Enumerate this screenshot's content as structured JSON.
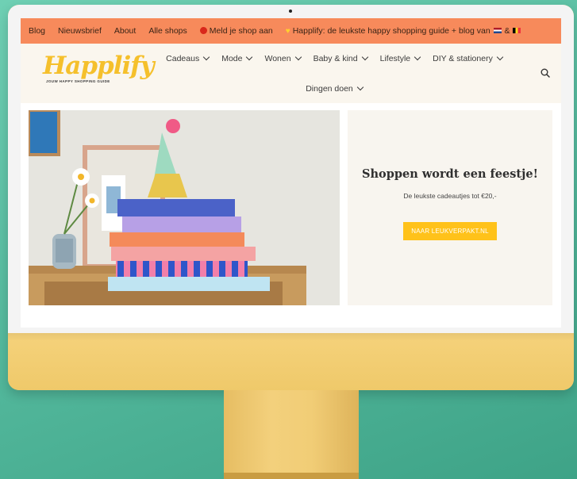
{
  "topbar": {
    "items": [
      "Blog",
      "Nieuwsbrief",
      "About",
      "Alle shops"
    ],
    "shop_label": "Meld je shop aan",
    "tagline": "Happlify: de leukste happy shopping guide + blog van",
    "tagline_amp": "&"
  },
  "logo": {
    "name": "Happlify",
    "tagline": "JOUW HAPPY SHOPPING GUIDE"
  },
  "nav": {
    "items": [
      "Cadeaus",
      "Mode",
      "Wonen",
      "Baby & kind",
      "Lifestyle",
      "DIY & stationery",
      "Dingen doen"
    ]
  },
  "icons": {
    "search": "search-icon",
    "heart": "yellow-heart-icon",
    "pin": "red-dot-icon"
  },
  "promo": {
    "title": "Shoppen wordt een feestje!",
    "subtitle": "De leukste cadeautjes tot €20,-",
    "button": "NAAR LEUKVERPAKT.NL"
  },
  "colors": {
    "topbar": "#f78a5b",
    "header_bg": "#faf6ee",
    "logo": "#f5c02c",
    "button": "#ffc21a",
    "monitor": "#f2cf76",
    "background": "#5cc3a5"
  }
}
